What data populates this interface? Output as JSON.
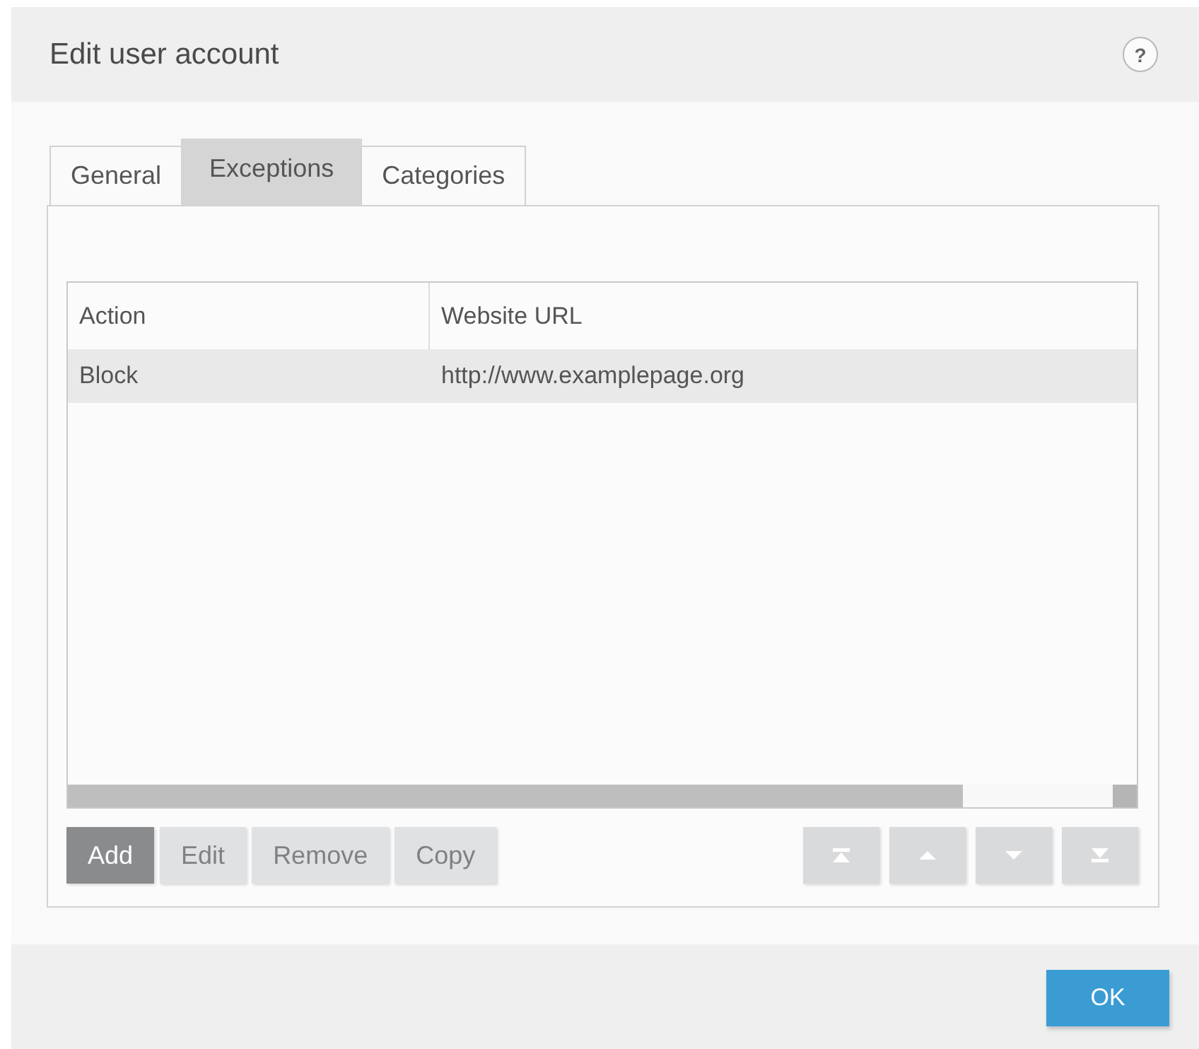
{
  "window": {
    "title": "Edit user account",
    "help_button": "?"
  },
  "tabs": [
    {
      "label": "General",
      "selected": false
    },
    {
      "label": "Exceptions",
      "selected": true
    },
    {
      "label": "Categories",
      "selected": false
    }
  ],
  "table": {
    "columns": [
      "Action",
      "Website URL"
    ],
    "rows": [
      {
        "cells": [
          "Block",
          "http://www.examplepage.org"
        ],
        "selected": true
      }
    ]
  },
  "buttons": [
    {
      "label": "Add",
      "disabled": false
    },
    {
      "label": "Edit",
      "disabled": true
    },
    {
      "label": "Remove",
      "disabled": true
    },
    {
      "label": "Copy",
      "disabled": true
    }
  ],
  "order_buttons": [
    {
      "kind": "top",
      "disabled": true
    },
    {
      "kind": "up",
      "disabled": true
    },
    {
      "kind": "down",
      "disabled": true
    },
    {
      "kind": "bottom",
      "disabled": true
    }
  ],
  "footer": {
    "ok_button": "OK"
  }
}
